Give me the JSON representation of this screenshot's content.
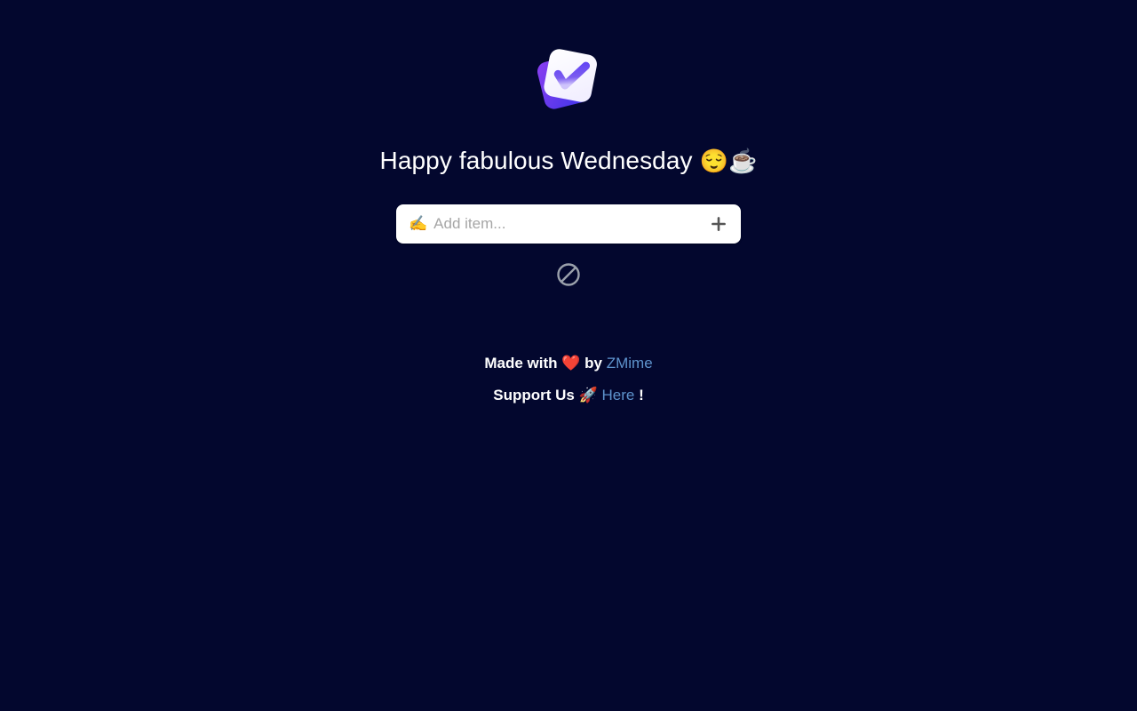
{
  "page": {
    "background_color": "#03072e",
    "text_color": "#ffffff",
    "link_color": "#5e93cd",
    "accent_color": "#5b3df5"
  },
  "logo": {
    "name": "todo-check-logo",
    "back_card_color": "#6b34e8",
    "front_card_color": "#ffffff",
    "check_color": "#5b3df5"
  },
  "header": {
    "greeting": "Happy fabulous Wednesday",
    "greeting_emoji_1": "😌",
    "greeting_emoji_2": "☕"
  },
  "add_item": {
    "pen_emoji": "✍️",
    "placeholder": "Add item...",
    "value": "",
    "add_button_label": "+"
  },
  "empty_state": {
    "icon": "no-entry-icon",
    "icon_color": "#9aa0ab"
  },
  "footer": {
    "made_with_prefix": "Made with",
    "heart_emoji": "❤️",
    "made_with_by": "by",
    "author_link": "ZMime",
    "support_prefix": "Support Us",
    "rocket_emoji": "🚀",
    "support_link": "Here",
    "support_suffix": "!"
  }
}
